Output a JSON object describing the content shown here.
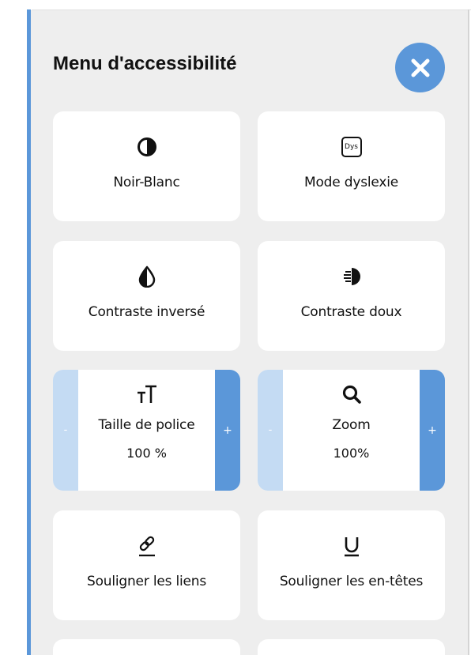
{
  "menu": {
    "title": "Menu d'accessibilité",
    "close_icon": "close-icon",
    "accent_color": "#5b97d9",
    "light_accent_color": "#c4dbf3"
  },
  "options": [
    {
      "label": "Noir-Blanc",
      "icon": "half-circle-icon"
    },
    {
      "label": "Mode dyslexie",
      "icon": "dys-icon",
      "icon_text": "Dys"
    },
    {
      "label": "Contraste inversé",
      "icon": "half-drop-icon"
    },
    {
      "label": "Contraste doux",
      "icon": "striped-circle-icon"
    },
    {
      "label": "Souligner les liens",
      "icon": "underlined-link-icon"
    },
    {
      "label": "Souligner les en-têtes",
      "icon": "underline-u-icon"
    }
  ],
  "font_size": {
    "label": "Taille de police",
    "value": "100 %",
    "minus": "-",
    "plus": "+",
    "icon": "text-size-icon",
    "icon_text": "TT"
  },
  "zoom": {
    "label": "Zoom",
    "value": "100%",
    "minus": "-",
    "plus": "+",
    "icon": "magnifier-icon"
  }
}
